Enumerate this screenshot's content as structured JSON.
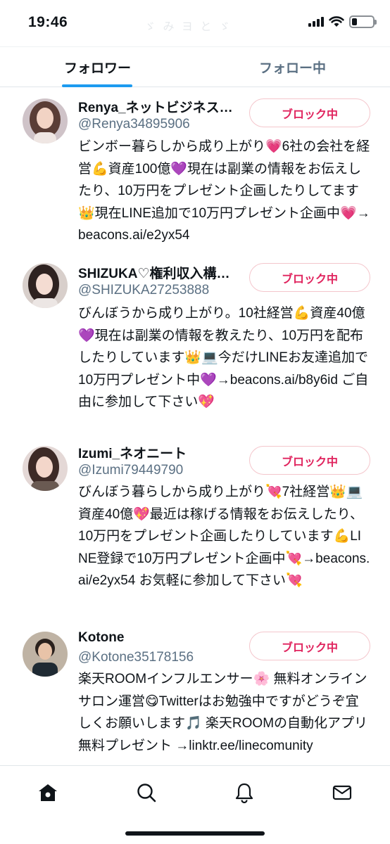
{
  "status_bar": {
    "time": "19:46",
    "faded_title": "ゞ み ヨ と ゞ"
  },
  "tabs": [
    {
      "label": "フォロワー",
      "active": true
    },
    {
      "label": "フォロー中",
      "active": false
    }
  ],
  "users": [
    {
      "name": "Renya_ネットビジネス…",
      "handle": "@Renya34895906",
      "button_label": "ブロック中",
      "bio": "ビンボー暮らしから成り上がり💗6社の会社を経営💪資産100億💜現在は副業の情報をお伝えしたり、10万円をプレゼント企画したりしてます👑現在LINE追加で10万円プレゼント企画中💗→beacons.ai/e2yx54"
    },
    {
      "name": "SHIZUKA♡権利収入構…",
      "handle": "@SHIZUKA27253888",
      "button_label": "ブロック中",
      "bio": "びんぼうから成り上がり。10社経営💪資産40億💜現在は副業の情報を教えたり、10万円を配布したりしています👑💻今だけLINEお友達追加で10万円プレゼント中💜→beacons.ai/b8y6id ご自由に参加して下さい💖"
    },
    {
      "name": "Izumi_ネオニート",
      "handle": "@Izumi79449790",
      "button_label": "ブロック中",
      "bio": "びんぼう暮らしから成り上がり💘7社経営👑💻資産40億💖最近は稼げる情報をお伝えしたり、10万円をプレゼント企画したりしています💪LINE登録で10万円プレゼント企画中💘→beacons.ai/e2yx54 お気軽に参加して下さい💘"
    },
    {
      "name": "Kotone",
      "handle": "@Kotone35178156",
      "button_label": "ブロック中",
      "bio": "楽天ROOMインフルエンサー🌸 無料オンラインサロン運営😋Twitterはお勉強中ですがどうぞ宜しくお願いします🎵 楽天ROOMの自動化アプリ無料プレゼント →linktr.ee/linecomunity"
    }
  ],
  "bottom_nav": [
    {
      "icon": "home-icon"
    },
    {
      "icon": "search-icon"
    },
    {
      "icon": "bell-icon"
    },
    {
      "icon": "mail-icon"
    }
  ],
  "colors": {
    "accent": "#1d9bf0",
    "block_red": "#e0245e",
    "secondary_text": "#5b7083"
  }
}
